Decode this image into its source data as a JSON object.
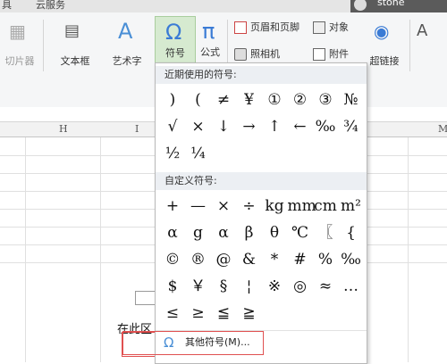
{
  "topbar": {
    "tab_left": "具",
    "tab_cloud": "云服务",
    "user_name": "stone"
  },
  "ribbon": {
    "clipboard_label": "切片器",
    "textbox_label": "文本框",
    "wordart_label": "艺术字",
    "symbol_label": "符号",
    "formula_label": "公式",
    "header_footer_label": "页眉和页脚",
    "object_label": "对象",
    "camera_label": "照相机",
    "attachment_label": "附件",
    "hyperlink_label": "超链接",
    "symbol_icon": "Ω",
    "formula_icon": "π",
    "wordart_icon": "A"
  },
  "columns": {
    "h": "H",
    "i": "I",
    "m": "M"
  },
  "cell": {
    "text": "在此区"
  },
  "dropdown": {
    "recent_title": "近期使用的符号:",
    "recent": [
      ")",
      "(",
      "≠",
      "¥",
      "①",
      "②",
      "③",
      "№",
      "√",
      "×",
      "↓",
      "→",
      "↑",
      "←",
      "‰",
      "¾",
      "½",
      "¼"
    ],
    "custom_title": "自定义符号:",
    "custom": [
      "+",
      "—",
      "×",
      "÷",
      "kg",
      "mm",
      "cm",
      "m²",
      "α",
      "g",
      "α",
      "β",
      "θ",
      "℃",
      "〖",
      "{",
      "©",
      "®",
      "@",
      "&",
      "*",
      "#",
      "%",
      "‰",
      "$",
      "￥",
      "§",
      "¦",
      "※",
      "◎",
      "≈",
      "…",
      "≤",
      "≥",
      "≦",
      "≧"
    ],
    "more_label": "其他符号(M)..."
  }
}
